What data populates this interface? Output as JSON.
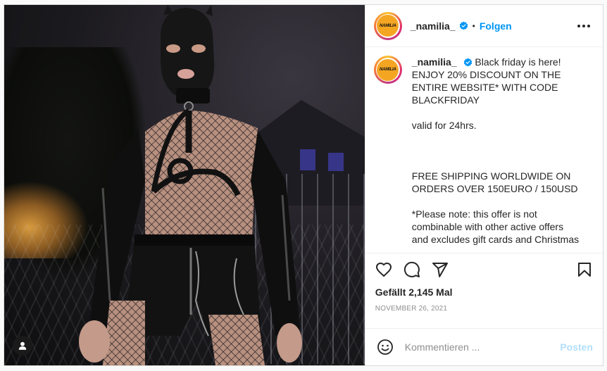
{
  "post": {
    "username": "_namilia_",
    "avatar_text": "NAMILIA",
    "follow_label": "Folgen",
    "dot": "•",
    "caption": {
      "line1": "Black friday is here!",
      "line2": "ENJOY 20% DISCOUNT ON THE",
      "line3": "ENTIRE WEBSITE* WITH CODE",
      "line4": "BLACKFRIDAY",
      "line5": "valid for 24hrs.",
      "line6": "FREE SHIPPING WORLDWIDE ON",
      "line7": "ORDERS OVER 150EURO / 150USD",
      "line8": "*Please note: this offer is not",
      "line9": "combinable with other active offers",
      "line10": "and excludes gift cards and Christmas"
    },
    "likes": "Gefällt 2,145 Mal",
    "date": "NOVEMBER 26, 2021",
    "comment_placeholder": "Kommentieren ...",
    "post_label": "Posten"
  },
  "colors": {
    "accent": "#0095f6",
    "post_disabled": "#b2dffc",
    "text": "#262626",
    "muted": "#8e8e8e",
    "avatar_fill": "#f4a623"
  },
  "icons": [
    "verified-badge-icon",
    "more-options-icon",
    "heart-icon",
    "comment-icon",
    "share-icon",
    "bookmark-icon",
    "emoji-icon",
    "user-tag-icon"
  ]
}
